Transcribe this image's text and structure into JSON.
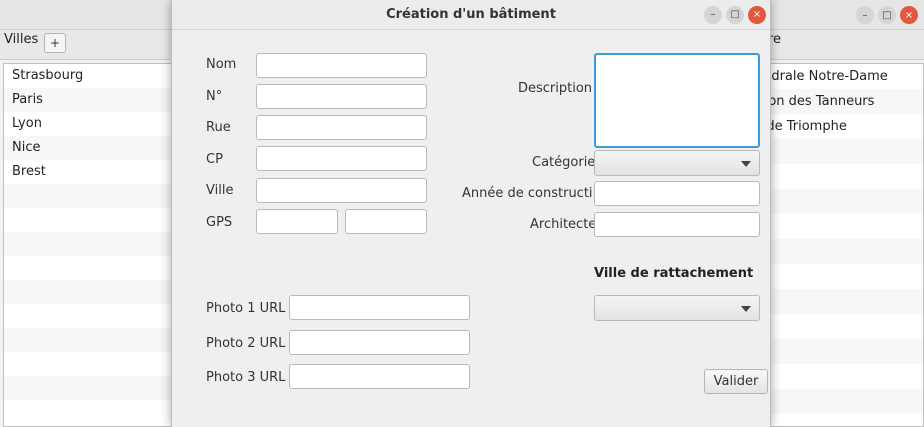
{
  "main": {
    "tab_villes": "Villes",
    "tab_add": "+",
    "tab_right_label": "re",
    "villes": [
      "Strasbourg",
      "Paris",
      "Lyon",
      "Nice",
      "Brest"
    ],
    "batiments": [
      "thédrale Notre-Dame",
      "aison des Tanneurs",
      "rc de Triomphe"
    ]
  },
  "dialog": {
    "title": "Création d'un bâtiment",
    "labels": {
      "nom": "Nom",
      "numero": "N°",
      "rue": "Rue",
      "cp": "CP",
      "ville": "Ville",
      "gps": "GPS",
      "photo1": "Photo 1 URL",
      "photo2": "Photo 2 URL",
      "photo3": "Photo 3 URL",
      "description": "Description",
      "categorie": "Catégorie",
      "annee": "Année de constructi",
      "architecte": "Architecte"
    },
    "section_ville": "Ville de rattachement",
    "validate_label": "Valider",
    "values": {
      "nom": "",
      "numero": "",
      "rue": "",
      "cp": "",
      "ville": "",
      "gps_lat": "",
      "gps_lon": "",
      "photo1": "",
      "photo2": "",
      "photo3": "",
      "description": "",
      "annee": "",
      "architecte": ""
    }
  },
  "window_buttons": {
    "minimize": "–",
    "maximize": "□",
    "close": "×"
  },
  "colors": {
    "focus": "#3b9bd8",
    "close": "#e2583e"
  }
}
